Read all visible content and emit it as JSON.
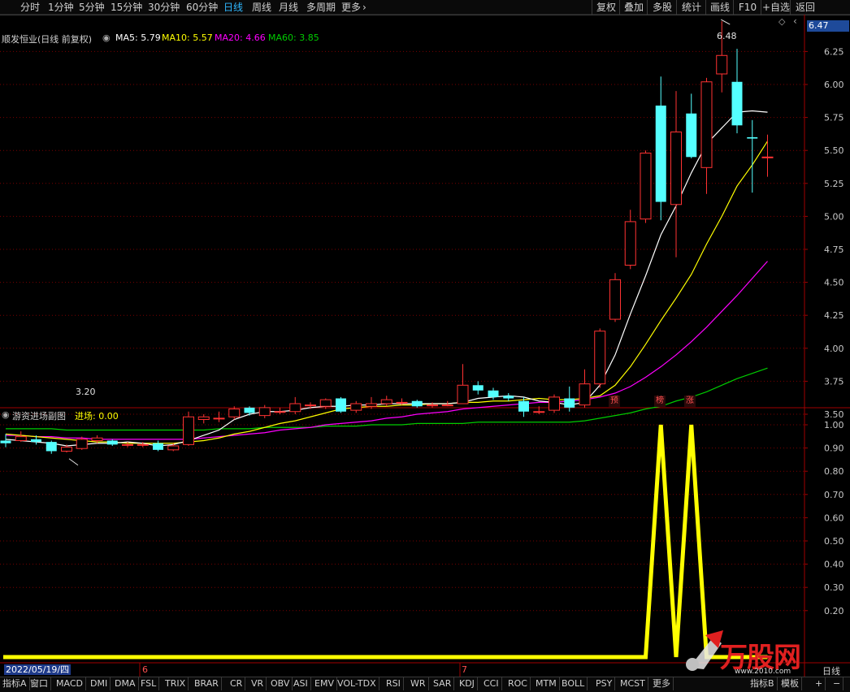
{
  "topbar": {
    "periods": [
      "分时",
      "1分钟",
      "5分钟",
      "15分钟",
      "30分钟",
      "60分钟",
      "日线",
      "周线",
      "月线",
      "多周期",
      "更多"
    ],
    "active_period": "日线",
    "more_arrow": "›",
    "right_buttons": [
      "复权",
      "叠加",
      "多股",
      "统计",
      "画线",
      "F10",
      "+自选",
      "返回"
    ]
  },
  "main_panel": {
    "title": "顺发恒业(日线 前复权)",
    "ma5": "MA5: 5.79",
    "ma10": "MA10: 5.57",
    "ma20": "MA20: 4.66",
    "ma60": "MA60: 3.85",
    "price_tag": "6.47",
    "high_label": "6.48",
    "low_label": "3.20",
    "y_axis": [
      "6.25",
      "6.00",
      "5.75",
      "5.50",
      "5.25",
      "5.00",
      "4.75",
      "4.50",
      "4.25",
      "4.00",
      "3.75",
      "3.50"
    ],
    "annotations": [
      "预",
      "榜",
      "涨"
    ],
    "colors": {
      "up": "#ff3232",
      "down": "#54ffff",
      "ma5": "#ffffff",
      "ma10": "#ffff00",
      "ma20": "#ff00ff",
      "ma60": "#00cc00",
      "grid": "#7a0000"
    }
  },
  "sub_panel": {
    "title": "游资进场副图",
    "value_label": "进场: 0.00",
    "y_axis": [
      "1.00",
      "0.90",
      "0.80",
      "0.70",
      "0.60",
      "0.50",
      "0.40",
      "0.30",
      "0.20"
    ],
    "line_color": "#ffff00"
  },
  "time_axis": {
    "date": "2022/05/19/四",
    "month6": "6",
    "month7": "7",
    "right_label": "日线"
  },
  "bottom_tabs": [
    "指标A",
    "窗口",
    "MACD",
    "DMI",
    "DMA",
    "FSL",
    "TRIX",
    "BRAR",
    "CR",
    "VR",
    "OBV",
    "ASI",
    "EMV",
    "VOL-TDX",
    "RSI",
    "WR",
    "SAR",
    "KDJ",
    "CCI",
    "ROC",
    "MTM",
    "BOLL",
    "PSY",
    "MCST",
    "更多"
  ],
  "bottom_right": [
    "指标B",
    "模板",
    "+",
    "−"
  ],
  "watermark": {
    "brand": "万股网",
    "url": "www.2010.com"
  },
  "chart_data": [
    {
      "type": "candlestick",
      "title": "顺发恒业(日线 前复权)",
      "ylim": [
        3.2,
        6.5
      ],
      "candles": [
        [
          3.3,
          3.28,
          3.35,
          3.25
        ],
        [
          3.3,
          3.33,
          3.37,
          3.29
        ],
        [
          3.31,
          3.29,
          3.34,
          3.27
        ],
        [
          3.29,
          3.22,
          3.3,
          3.2
        ],
        [
          3.22,
          3.25,
          3.27,
          3.21
        ],
        [
          3.24,
          3.31,
          3.33,
          3.23
        ],
        [
          3.3,
          3.32,
          3.34,
          3.28
        ],
        [
          3.3,
          3.27,
          3.31,
          3.26
        ],
        [
          3.27,
          3.27,
          3.29,
          3.25
        ],
        [
          3.27,
          3.27,
          3.29,
          3.25
        ],
        [
          3.28,
          3.23,
          3.3,
          3.22
        ],
        [
          3.23,
          3.26,
          3.28,
          3.22
        ],
        [
          3.27,
          3.48,
          3.52,
          3.26
        ],
        [
          3.46,
          3.48,
          3.5,
          3.43
        ],
        [
          3.47,
          3.47,
          3.52,
          3.44
        ],
        [
          3.48,
          3.54,
          3.56,
          3.46
        ],
        [
          3.55,
          3.51,
          3.56,
          3.49
        ],
        [
          3.49,
          3.55,
          3.57,
          3.47
        ],
        [
          3.52,
          3.52,
          3.55,
          3.5
        ],
        [
          3.52,
          3.58,
          3.63,
          3.5
        ],
        [
          3.57,
          3.57,
          3.59,
          3.54
        ],
        [
          3.56,
          3.61,
          3.62,
          3.54
        ],
        [
          3.62,
          3.52,
          3.63,
          3.51
        ],
        [
          3.53,
          3.58,
          3.6,
          3.51
        ],
        [
          3.56,
          3.58,
          3.63,
          3.54
        ],
        [
          3.58,
          3.61,
          3.64,
          3.56
        ],
        [
          3.59,
          3.59,
          3.62,
          3.57
        ],
        [
          3.6,
          3.56,
          3.61,
          3.55
        ],
        [
          3.57,
          3.57,
          3.59,
          3.55
        ],
        [
          3.57,
          3.57,
          3.6,
          3.56
        ],
        [
          3.58,
          3.72,
          3.88,
          3.58
        ],
        [
          3.72,
          3.68,
          3.75,
          3.65
        ],
        [
          3.68,
          3.63,
          3.7,
          3.61
        ],
        [
          3.64,
          3.62,
          3.66,
          3.6
        ],
        [
          3.6,
          3.52,
          3.63,
          3.48
        ],
        [
          3.52,
          3.52,
          3.56,
          3.5
        ],
        [
          3.53,
          3.63,
          3.65,
          3.51
        ],
        [
          3.62,
          3.55,
          3.71,
          3.52
        ],
        [
          3.57,
          3.73,
          3.84,
          3.55
        ],
        [
          3.73,
          4.13,
          4.15,
          3.7
        ],
        [
          4.22,
          4.52,
          4.57,
          4.2
        ],
        [
          4.63,
          4.96,
          5.05,
          4.6
        ],
        [
          4.98,
          5.48,
          5.5,
          4.95
        ],
        [
          5.84,
          5.11,
          6.06,
          4.97
        ],
        [
          5.09,
          5.64,
          5.95,
          4.69
        ],
        [
          5.78,
          5.45,
          5.93,
          5.44
        ],
        [
          5.37,
          6.02,
          6.05,
          5.17
        ],
        [
          6.08,
          6.22,
          6.48,
          5.94
        ],
        [
          6.02,
          5.69,
          6.27,
          5.63
        ],
        [
          5.6,
          5.59,
          5.73,
          5.18
        ],
        [
          5.45,
          5.45,
          5.62,
          5.3
        ]
      ],
      "ma5": [
        3.31,
        3.3,
        3.29,
        3.28,
        3.26,
        3.27,
        3.28,
        3.28,
        3.29,
        3.28,
        3.26,
        3.27,
        3.3,
        3.34,
        3.38,
        3.46,
        3.5,
        3.52,
        3.52,
        3.53,
        3.55,
        3.56,
        3.56,
        3.57,
        3.57,
        3.58,
        3.58,
        3.58,
        3.58,
        3.58,
        3.59,
        3.62,
        3.63,
        3.64,
        3.63,
        3.6,
        3.59,
        3.57,
        3.59,
        3.72,
        3.95,
        4.26,
        4.55,
        4.86,
        5.08,
        5.33,
        5.55,
        5.67,
        5.79,
        5.8,
        5.79
      ],
      "ma10": [
        3.35,
        3.34,
        3.33,
        3.32,
        3.31,
        3.3,
        3.29,
        3.29,
        3.28,
        3.28,
        3.28,
        3.28,
        3.29,
        3.3,
        3.32,
        3.35,
        3.37,
        3.4,
        3.43,
        3.45,
        3.48,
        3.51,
        3.54,
        3.55,
        3.56,
        3.56,
        3.57,
        3.57,
        3.58,
        3.58,
        3.59,
        3.59,
        3.6,
        3.6,
        3.61,
        3.62,
        3.61,
        3.61,
        3.62,
        3.64,
        3.72,
        3.86,
        4.03,
        4.21,
        4.38,
        4.56,
        4.79,
        5.0,
        5.23,
        5.39,
        5.57
      ],
      "ma20": [
        3.34,
        3.34,
        3.33,
        3.33,
        3.32,
        3.32,
        3.31,
        3.31,
        3.31,
        3.31,
        3.31,
        3.31,
        3.31,
        3.32,
        3.33,
        3.34,
        3.35,
        3.36,
        3.38,
        3.39,
        3.4,
        3.42,
        3.43,
        3.44,
        3.45,
        3.47,
        3.48,
        3.5,
        3.51,
        3.52,
        3.54,
        3.55,
        3.56,
        3.57,
        3.58,
        3.59,
        3.59,
        3.6,
        3.61,
        3.63,
        3.66,
        3.71,
        3.78,
        3.86,
        3.95,
        4.05,
        4.16,
        4.28,
        4.4,
        4.53,
        4.66
      ],
      "ma60": [
        3.39,
        3.39,
        3.39,
        3.39,
        3.38,
        3.38,
        3.38,
        3.38,
        3.38,
        3.38,
        3.38,
        3.38,
        3.38,
        3.38,
        3.39,
        3.39,
        3.39,
        3.4,
        3.4,
        3.4,
        3.4,
        3.41,
        3.41,
        3.41,
        3.42,
        3.42,
        3.42,
        3.43,
        3.43,
        3.43,
        3.43,
        3.44,
        3.44,
        3.44,
        3.44,
        3.44,
        3.44,
        3.44,
        3.45,
        3.47,
        3.49,
        3.51,
        3.54,
        3.56,
        3.6,
        3.63,
        3.67,
        3.72,
        3.77,
        3.81,
        3.85
      ],
      "y_ticks": [
        6.25,
        6.0,
        5.75,
        5.5,
        5.25,
        5.0,
        4.75,
        4.5,
        4.25,
        4.0,
        3.75,
        3.5
      ]
    },
    {
      "type": "line",
      "title": "游资进场副图",
      "ylim": [
        0,
        1.0
      ],
      "series": [
        {
          "name": "进场",
          "values": [
            0,
            0,
            0,
            0,
            0,
            0,
            0,
            0,
            0,
            0,
            0,
            0,
            0,
            0,
            0,
            0,
            0,
            0,
            0,
            0,
            0,
            0,
            0,
            0,
            0,
            0,
            0,
            0,
            0,
            0,
            0,
            0,
            0,
            0,
            0,
            0,
            0,
            0,
            0,
            0,
            0,
            0,
            0,
            1,
            0,
            1,
            0,
            0,
            0,
            0,
            0
          ]
        }
      ],
      "y_ticks": [
        1.0,
        0.9,
        0.8,
        0.7,
        0.6,
        0.5,
        0.4,
        0.3,
        0.2
      ]
    }
  ]
}
